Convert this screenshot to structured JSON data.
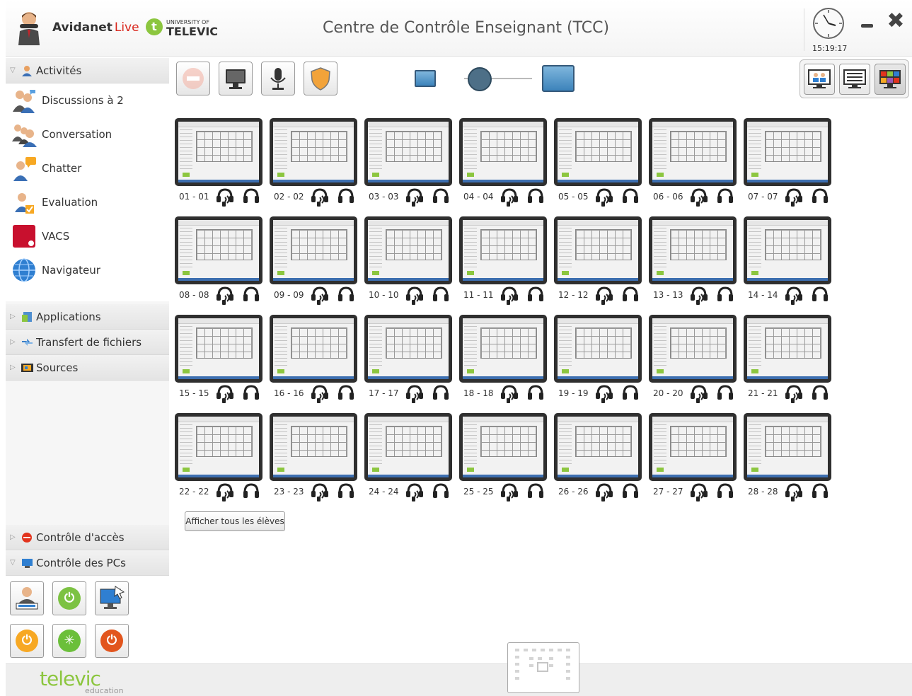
{
  "header": {
    "brand": "Avidanet",
    "brand_live": "Live",
    "televic_badge": "t",
    "univ_line1": "UNIVERSITY OF",
    "univ_line2": "TELEVIC",
    "title": "Centre de Contrôle Enseignant (TCC)",
    "clock_time": "15:19:17",
    "close_glyph": "✖"
  },
  "sidebar": {
    "activities_header": "Activités",
    "activities": [
      {
        "label": "Discussions à 2",
        "icon": "pair-discussion-icon"
      },
      {
        "label": "Conversation",
        "icon": "conversation-icon"
      },
      {
        "label": "Chatter",
        "icon": "chat-icon"
      },
      {
        "label": "Evaluation",
        "icon": "evaluation-icon"
      },
      {
        "label": "VACS",
        "icon": "vacs-icon"
      },
      {
        "label": "Navigateur",
        "icon": "globe-icon"
      }
    ],
    "sections": [
      {
        "label": "Applications",
        "icon": "applications-icon"
      },
      {
        "label": "Transfert de fichiers",
        "icon": "file-transfer-icon"
      },
      {
        "label": "Sources",
        "icon": "sources-icon"
      }
    ],
    "access_control": "Contrôle d'accès",
    "pc_control": "Contrôle des PCs",
    "pc_tools": [
      {
        "name": "login-user-icon",
        "color": "#ffffff"
      },
      {
        "name": "power-on-icon",
        "color": "#7cc242"
      },
      {
        "name": "remote-desktop-icon",
        "color": "#2a7fc0"
      },
      {
        "name": "standby-icon",
        "color": "#f7a823"
      },
      {
        "name": "restart-icon",
        "color": "#6bbf3a"
      },
      {
        "name": "shutdown-icon",
        "color": "#e2551d"
      }
    ]
  },
  "toolbar": {
    "buttons": [
      "block-icon",
      "monitor-icon",
      "microphone-icon",
      "shield-icon"
    ],
    "zoom_level": 0.3,
    "views": [
      "students-view-icon",
      "list-view-icon",
      "thumbnail-view-icon"
    ]
  },
  "students": [
    {
      "label": "01 - 01"
    },
    {
      "label": "02 - 02"
    },
    {
      "label": "03 - 03"
    },
    {
      "label": "04 - 04"
    },
    {
      "label": "05 - 05"
    },
    {
      "label": "06 - 06"
    },
    {
      "label": "07 - 07"
    },
    {
      "label": "08 - 08"
    },
    {
      "label": "09 - 09"
    },
    {
      "label": "10 - 10"
    },
    {
      "label": "11 - 11"
    },
    {
      "label": "12 - 12"
    },
    {
      "label": "13 - 13"
    },
    {
      "label": "14 - 14"
    },
    {
      "label": "15 - 15"
    },
    {
      "label": "16 - 16"
    },
    {
      "label": "17 - 17"
    },
    {
      "label": "18 - 18"
    },
    {
      "label": "19 - 19"
    },
    {
      "label": "20 - 20"
    },
    {
      "label": "21 - 21"
    },
    {
      "label": "22 - 22"
    },
    {
      "label": "23 - 23"
    },
    {
      "label": "24 - 24"
    },
    {
      "label": "25 - 25"
    },
    {
      "label": "26 - 26"
    },
    {
      "label": "27 - 27"
    },
    {
      "label": "28 - 28"
    }
  ],
  "show_all_button": "Afficher tous les élèves",
  "footer": {
    "logo": "televic",
    "logo_sub": "education"
  },
  "colors": {
    "accent_green": "#8cc63f",
    "live_red": "#d9261c",
    "monitor_frame": "#2f2f2f"
  }
}
